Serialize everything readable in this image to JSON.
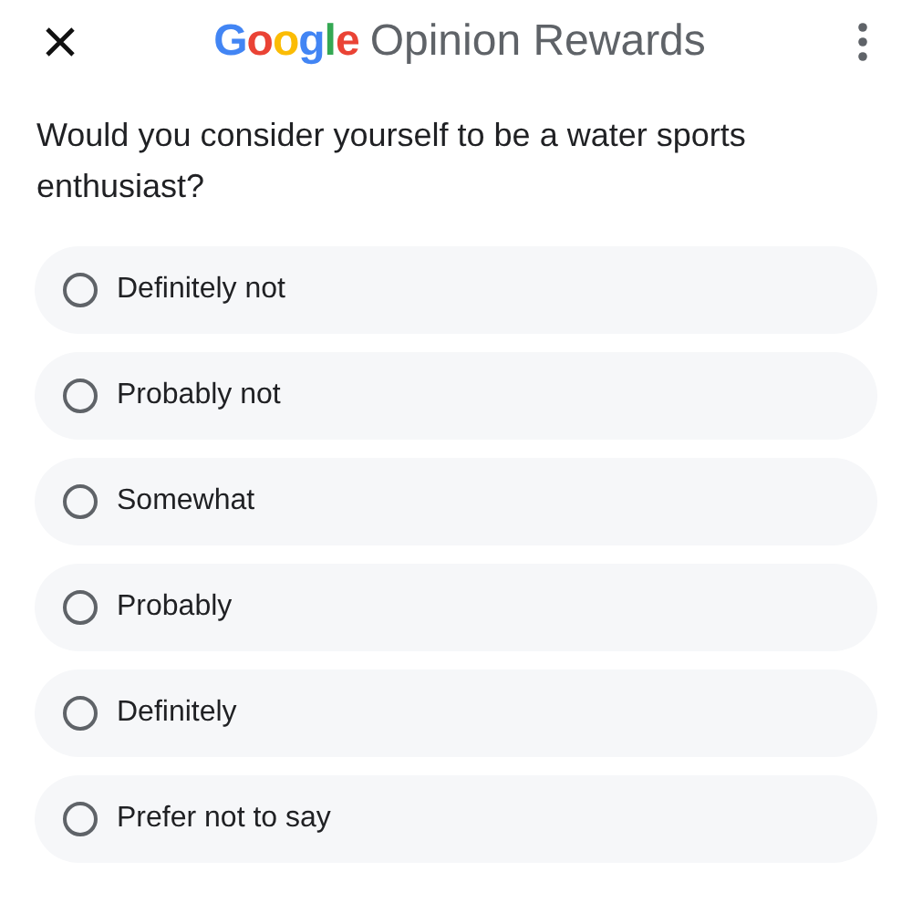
{
  "header": {
    "logo": "Google",
    "title": "Opinion Rewards"
  },
  "question": "Would you consider yourself to be a water sports enthusiast?",
  "options": [
    {
      "label": "Definitely not",
      "selected": false
    },
    {
      "label": "Probably not",
      "selected": false
    },
    {
      "label": "Somewhat",
      "selected": false
    },
    {
      "label": "Probably",
      "selected": false
    },
    {
      "label": "Definitely",
      "selected": false
    },
    {
      "label": "Prefer not to say",
      "selected": false
    }
  ]
}
